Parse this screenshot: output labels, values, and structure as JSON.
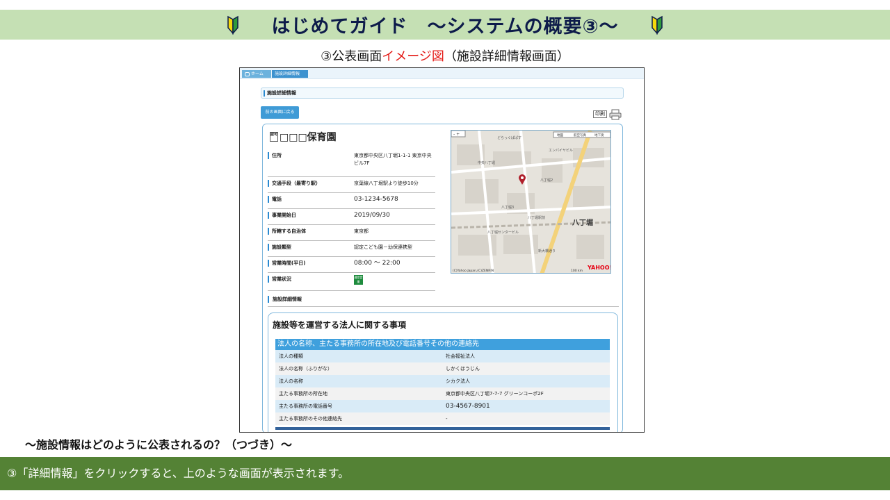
{
  "slide": {
    "title": "はじめてガイド　～システムの概要③～",
    "subtitle_prefix": "③公表画面",
    "subtitle_highlight": "イメージ図",
    "subtitle_suffix": "（施設詳細情報画面）",
    "question": "～施設情報はどのように公表されるの？（つづき）～",
    "footer": "③「詳細情報」をクリックすると、上のような画面が表示されます。"
  },
  "colors": {
    "title_band": "#c5e0b4",
    "footer_band": "#548235",
    "accent_red": "#e41b17",
    "site_blue": "#3fa0dd"
  },
  "screen": {
    "breadcrumb": [
      "ホーム",
      "施設詳細情報"
    ],
    "section_label": "施設詳細情報",
    "back_button": "前の画面に戻る",
    "print_button": "印刷",
    "facility_name": "□□□保育園",
    "facility_icon": "認可",
    "info": [
      {
        "label": "住所",
        "value": "東京都中央区八丁堀1-1-1 東京中央ビル7F"
      },
      {
        "label": "交通手段（最寄り駅）",
        "value": "京葉線八丁堀駅より徒歩10分"
      },
      {
        "label": "電話",
        "value": "03-1234-5678"
      },
      {
        "label": "事業開始日",
        "value": "2019/09/30"
      },
      {
        "label": "所轄する自治体",
        "value": "東京都"
      },
      {
        "label": "施設類型",
        "value": "認定こども園－幼保連携型"
      },
      {
        "label": "営業時間(平日)",
        "value": "08:00 ～ 22:00"
      },
      {
        "label": "営業状況",
        "value": "通常営業"
      }
    ],
    "map": {
      "station": "八丁堀",
      "buttons": [
        "地図",
        "航空写真",
        "地下街"
      ],
      "copyright": "(C)Yahoo Japan,(C)ZENRIN",
      "scale": "100 km",
      "brand": "YAHOO!",
      "labels": [
        "どらっぐぱぱす",
        "エンパイヤビル",
        "中央八丁堀",
        "八丁堀2",
        "八丁堀3",
        "八丁堀駅前",
        "八丁堀センタービル",
        "新大橋通り"
      ]
    },
    "detail_heading": "施設詳細情報",
    "corp_section": {
      "title": "施設等を運営する法人に関する事項",
      "band": "法人の名称、主たる事務所の所在地及び電話番号その他の連絡先",
      "rows": [
        {
          "label": "法人の種類",
          "value": "社会福祉法人"
        },
        {
          "label": "法人の名称（ふりがな）",
          "value": "しかくほうじん"
        },
        {
          "label": "法人の名称",
          "value": "シカク法人"
        },
        {
          "label": "主たる事務所の所在地",
          "value": "東京都中央区八丁堀7-7-7 グリーンコーポ2F"
        },
        {
          "label": "主たる事務所の電話番号",
          "value": "03-4567-8901"
        },
        {
          "label": "主たる事務所のその他連絡先",
          "value": "-"
        }
      ]
    }
  }
}
